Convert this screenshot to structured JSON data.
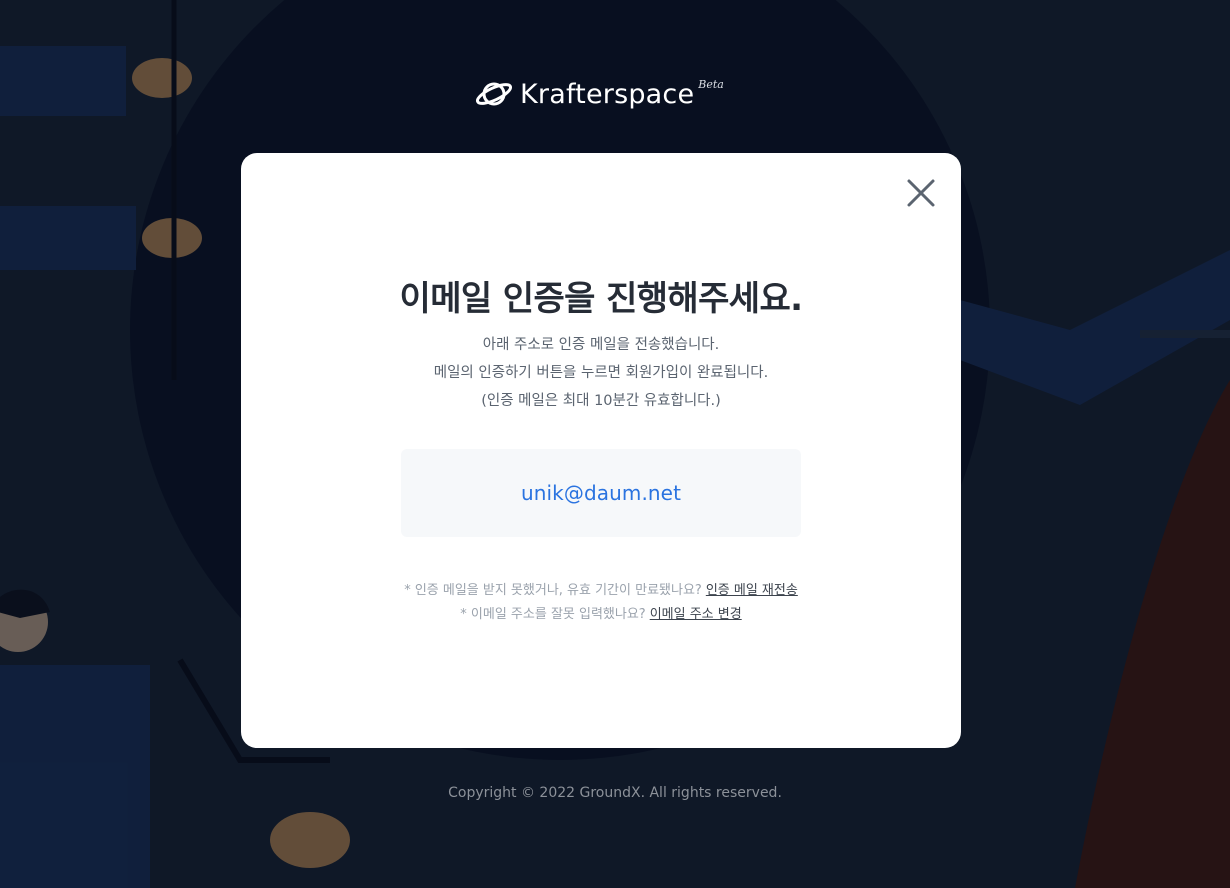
{
  "brand": {
    "name": "Krafterspace",
    "badge": "Beta",
    "logo_icon": "planet-icon"
  },
  "modal": {
    "close_icon": "close-icon",
    "title": "이메일 인증을 진행해주세요.",
    "description": [
      "아래 주소로 인증 메일을 전송했습니다.",
      "메일의 인증하기 버튼을 누르면 회원가입이 완료됩니다.",
      "(인증 메일은 최대 10분간 유효합니다.)"
    ],
    "email": "unik@daum.net",
    "help": {
      "resend_prompt": "* 인증 메일을 받지 못했거나, 유효 기간이 만료됐나요?",
      "resend_link": "인증 메일 재전송",
      "change_prompt": "* 이메일 주소를 잘못 입력했나요?",
      "change_link": "이메일 주소 변경"
    }
  },
  "footer": {
    "copyright": "Copyright © 2022 GroundX. All rights reserved."
  },
  "colors": {
    "email_accent": "#2a73e0",
    "title_text": "#262c36",
    "background_dark": "#0f1b2d"
  }
}
